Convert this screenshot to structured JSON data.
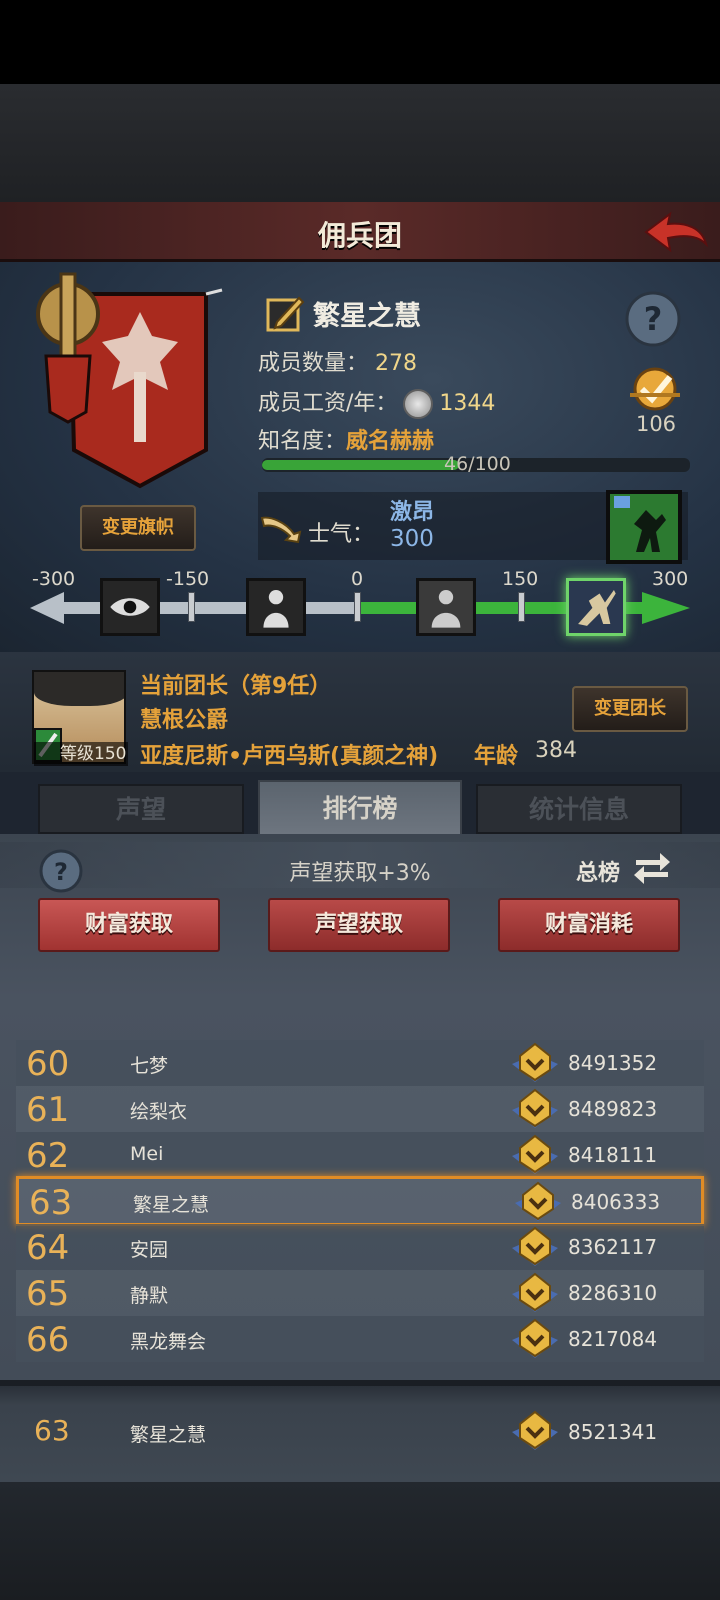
{
  "header": {
    "title": "佣兵团"
  },
  "guild": {
    "name": "繁星之慧",
    "members_label": "成员数量：",
    "members_value": "278",
    "salary_label": "成员工资/年：",
    "salary_value": "1344",
    "fame_label": "知名度：",
    "fame_word": "威名赫赫",
    "fame_progress": "46/100",
    "fame_fraction": 0.46,
    "rank_number": "106",
    "change_flag_label": "变更旗帜"
  },
  "morale": {
    "label": "士气：",
    "word": "激昂",
    "value": "300",
    "scale_labels": [
      "-300",
      "-150",
      "0",
      "150",
      "300"
    ]
  },
  "leader": {
    "title": "当前团长（第9任）",
    "rank": "慧根公爵",
    "name": "亚度尼斯•卢西乌斯(真颜之神)",
    "age_label": "年龄",
    "age": "384",
    "level": "等级150",
    "change_leader_label": "变更团长"
  },
  "tabs": [
    {
      "label": "声望",
      "active": false
    },
    {
      "label": "排行榜",
      "active": true
    },
    {
      "label": "统计信息",
      "active": false
    }
  ],
  "leaderboard": {
    "bonus_text": "声望获取+3%",
    "total_label": "总榜",
    "categories": [
      "财富获取",
      "声望获取",
      "财富消耗"
    ],
    "rows": [
      {
        "rank": "60",
        "name": "七梦",
        "score": "8491352"
      },
      {
        "rank": "61",
        "name": "绘梨衣",
        "score": "8489823"
      },
      {
        "rank": "62",
        "name": "Mei",
        "score": "8418111"
      },
      {
        "rank": "63",
        "name": "繁星之慧",
        "score": "8406333"
      },
      {
        "rank": "64",
        "name": "安园",
        "score": "8362117"
      },
      {
        "rank": "65",
        "name": "静默",
        "score": "8286310"
      },
      {
        "rank": "66",
        "name": "黑龙舞会",
        "score": "8217084"
      }
    ],
    "my_row": {
      "rank": "63",
      "name": "繁星之慧",
      "score": "8521341"
    }
  },
  "colors": {
    "accent_orange": "#e5a23a",
    "rank_gold": "#e9b258",
    "morale_blue": "#8cb6e6",
    "progress_green": "#39a438",
    "button_red": "#a13331",
    "highlight_orange": "#e08c26"
  }
}
